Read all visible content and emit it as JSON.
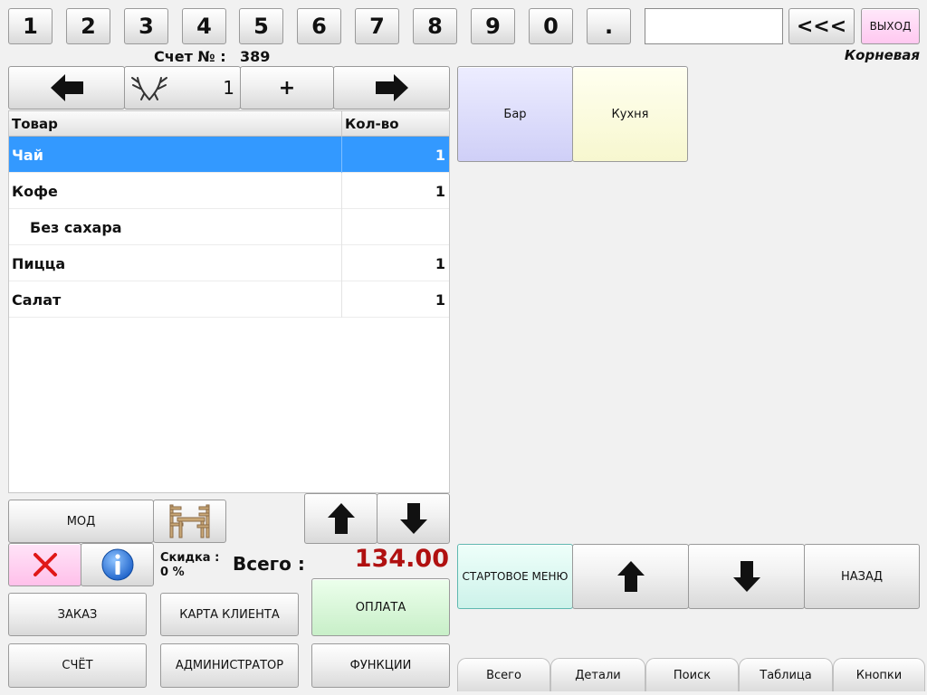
{
  "keypad": {
    "keys": [
      "1",
      "2",
      "3",
      "4",
      "5",
      "6",
      "7",
      "8",
      "9",
      "0",
      "."
    ],
    "input_value": "",
    "backspace_label": "<<<",
    "exit_label": "ВЫХОД"
  },
  "header": {
    "account_label": "Счет № :",
    "account_number": "389",
    "location": "Корневая"
  },
  "toolbar": {
    "quantity": "1",
    "plus_label": "+"
  },
  "order_table": {
    "columns": [
      "Товар",
      "Кол-во"
    ],
    "rows": [
      {
        "item": "Чай",
        "qty": "1"
      },
      {
        "item": "Кофе",
        "qty": "1"
      },
      {
        "item": "Без сахара",
        "qty": ""
      },
      {
        "item": "Пицца",
        "qty": "1"
      },
      {
        "item": "Салат",
        "qty": "1"
      }
    ]
  },
  "categories": {
    "bar": "Бар",
    "kitchen": "Кухня"
  },
  "bottom_left": {
    "mod_label": "МОД",
    "discount_label": "Скидка :",
    "discount_value": "0 %",
    "total_label": "Всего :",
    "total_value": "134.00",
    "order_label": "ЗАКАЗ",
    "client_card_label": "КАРТА КЛИЕНТА",
    "payment_label": "ОПЛАТА",
    "bill_label": "СЧЁТ",
    "admin_label": "АДМИНИСТРАТОР",
    "functions_label": "ФУНКЦИИ"
  },
  "menu_nav": {
    "start_menu_label": "СТАРТОВОЕ МЕНЮ",
    "back_label": "НАЗАД"
  },
  "tabs": [
    "Всего",
    "Детали",
    "Поиск",
    "Таблица",
    "Кнопки"
  ],
  "colors": {
    "selected_row": "#3399ff",
    "total_value": "#b01010",
    "bar_category": "#d6d6ff",
    "kitchen_category": "#ffffd6",
    "payment_button": "#d8f7d8",
    "start_menu_button": "#d8f7f0",
    "exit_button": "#ffd6f5",
    "delete_button": "#ffd0f0"
  }
}
